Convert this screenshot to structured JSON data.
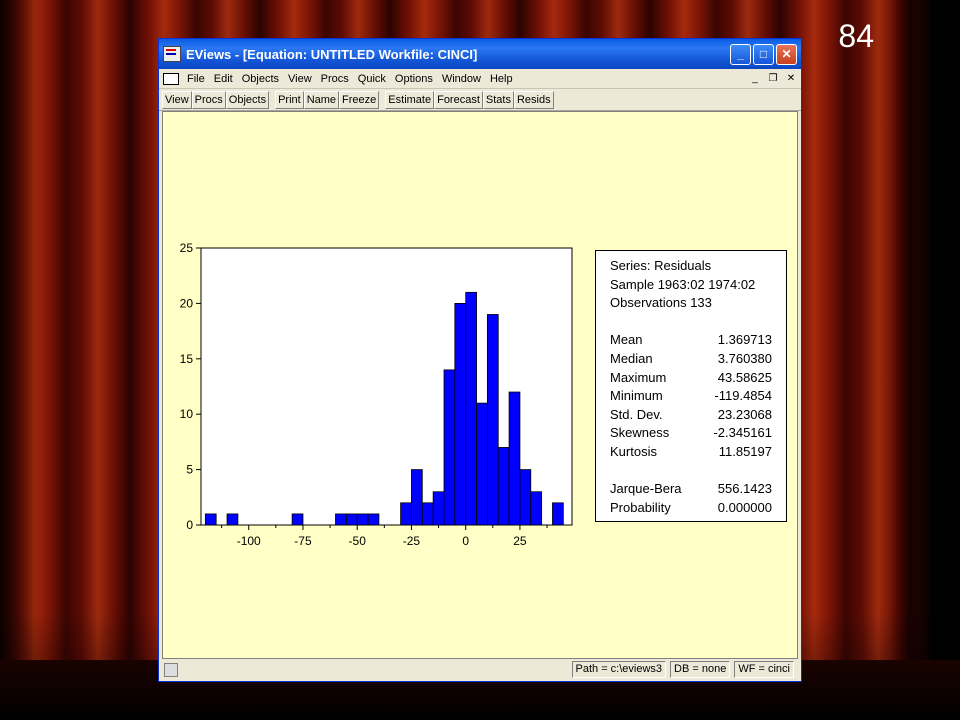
{
  "slide": {
    "number": "84"
  },
  "window": {
    "title": "EViews - [Equation: UNTITLED   Workfile: CINCI]",
    "controls": {
      "minimize": "_",
      "maximize": "□",
      "close": "✕"
    }
  },
  "menubar": {
    "items": [
      "File",
      "Edit",
      "Objects",
      "View",
      "Procs",
      "Quick",
      "Options",
      "Window",
      "Help"
    ],
    "mdi": {
      "minimize": "_",
      "restore": "❐",
      "close": "✕"
    }
  },
  "toolbar": {
    "groups": [
      [
        "View",
        "Procs",
        "Objects"
      ],
      [
        "Print",
        "Name",
        "Freeze"
      ],
      [
        "Estimate",
        "Forecast",
        "Stats",
        "Resids"
      ]
    ]
  },
  "statusbar": {
    "path": "Path = c:\\eviews3",
    "db": "DB = none",
    "wf": "WF = cinci"
  },
  "stats": {
    "header": [
      "Series: Residuals",
      "Sample 1963:02 1974:02",
      "Observations 133"
    ],
    "moments": [
      {
        "label": "Mean",
        "value": "1.369713"
      },
      {
        "label": "Median",
        "value": "3.760380"
      },
      {
        "label": "Maximum",
        "value": "43.58625"
      },
      {
        "label": "Minimum",
        "value": "-119.4854"
      },
      {
        "label": "Std. Dev.",
        "value": "23.23068"
      },
      {
        "label": "Skewness",
        "value": "-2.345161"
      },
      {
        "label": "Kurtosis",
        "value": "11.85197"
      }
    ],
    "tests": [
      {
        "label": "Jarque-Bera",
        "value": "556.1423"
      },
      {
        "label": "Probability",
        "value": "0.000000"
      }
    ]
  },
  "chart_data": {
    "type": "bar",
    "title": "",
    "xlabel": "",
    "ylabel": "",
    "bin_width": 5,
    "bins": [
      {
        "x": -117.5,
        "count": 1
      },
      {
        "x": -107.5,
        "count": 1
      },
      {
        "x": -77.5,
        "count": 1
      },
      {
        "x": -57.5,
        "count": 1
      },
      {
        "x": -52.5,
        "count": 1
      },
      {
        "x": -47.5,
        "count": 1
      },
      {
        "x": -42.5,
        "count": 1
      },
      {
        "x": -27.5,
        "count": 2
      },
      {
        "x": -22.5,
        "count": 5
      },
      {
        "x": -17.5,
        "count": 2
      },
      {
        "x": -12.5,
        "count": 3
      },
      {
        "x": -7.5,
        "count": 14
      },
      {
        "x": -2.5,
        "count": 20
      },
      {
        "x": 2.5,
        "count": 21
      },
      {
        "x": 7.5,
        "count": 11
      },
      {
        "x": 12.5,
        "count": 19
      },
      {
        "x": 17.5,
        "count": 7
      },
      {
        "x": 22.5,
        "count": 12
      },
      {
        "x": 27.5,
        "count": 5
      },
      {
        "x": 32.5,
        "count": 3
      },
      {
        "x": 42.5,
        "count": 2
      }
    ],
    "xlim": [
      -122,
      49
    ],
    "ylim": [
      0,
      25
    ],
    "xticks": [
      -100,
      -75,
      -50,
      -25,
      0,
      25
    ],
    "yticks": [
      0,
      5,
      10,
      15,
      20,
      25
    ],
    "bar_color": "#0000ff",
    "grid": false
  }
}
